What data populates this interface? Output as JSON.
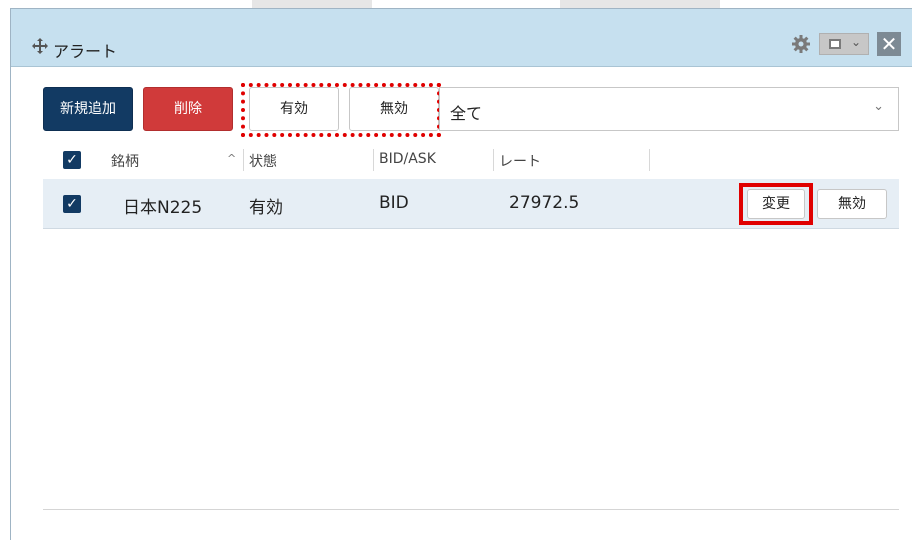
{
  "window": {
    "title": "アラート",
    "close_glyph": "✕"
  },
  "toolbar": {
    "new_label": "新規追加",
    "delete_label": "削除",
    "valid_label": "有効",
    "invalid_label": "無効",
    "filter_value": "全て"
  },
  "table": {
    "headers": {
      "symbol": "銘柄",
      "status": "状態",
      "bidask": "BID/ASK",
      "rate": "レート"
    },
    "rows": [
      {
        "checked": true,
        "symbol": "日本N225",
        "status": "有効",
        "bidask": "BID",
        "rate": "27972.5",
        "change_label": "変更",
        "invalid_label": "無効"
      }
    ]
  },
  "icons": {
    "move": "move-icon",
    "gear": "gear-icon",
    "window_mode": "window-mode-icon",
    "close": "close-icon",
    "sort": "sort-ascending-icon",
    "checkbox": "checkbox-checked-icon"
  },
  "colors": {
    "titlebar": "#c6e0ef",
    "primary_button": "#123a63",
    "danger_button": "#d03a3a",
    "highlight_red": "#e00000",
    "selected_row": "#e6eef5"
  }
}
